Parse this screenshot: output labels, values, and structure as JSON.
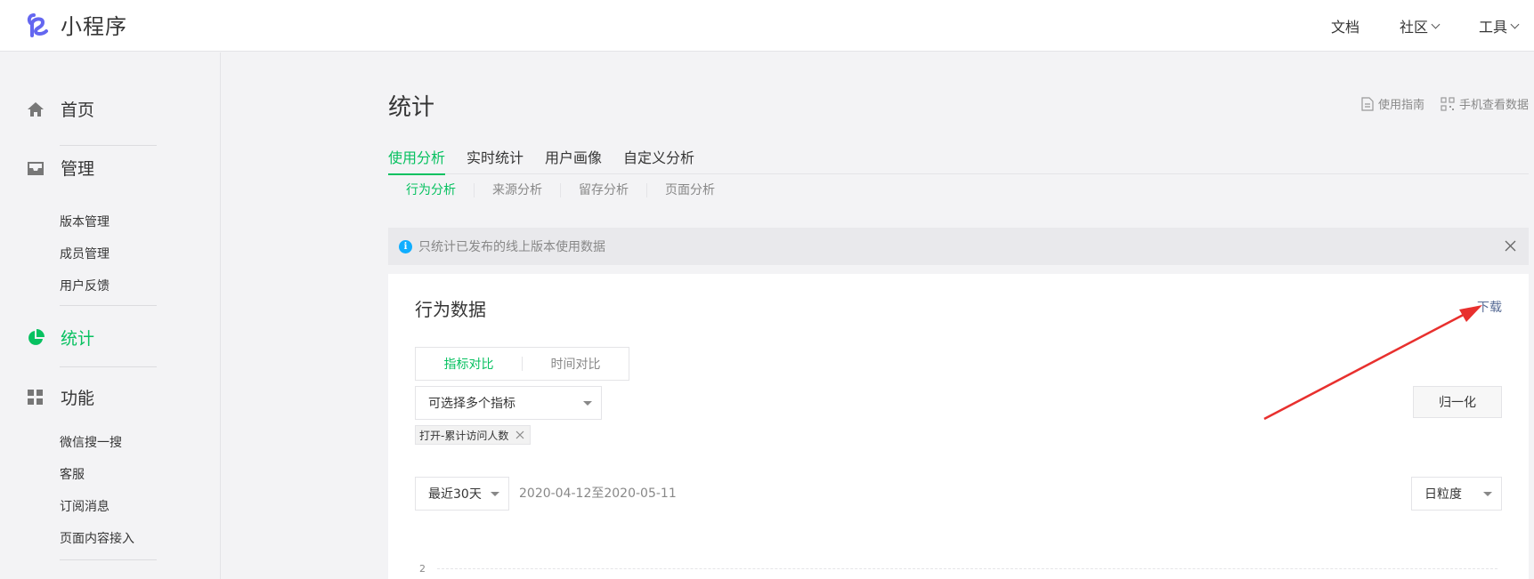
{
  "header": {
    "app_title": "小程序",
    "nav": [
      {
        "label": "文档",
        "has_dropdown": false
      },
      {
        "label": "社区",
        "has_dropdown": true
      },
      {
        "label": "工具",
        "has_dropdown": true
      }
    ]
  },
  "sidebar": {
    "home": "首页",
    "manage": "管理",
    "manage_items": [
      "版本管理",
      "成员管理",
      "用户反馈"
    ],
    "stats": "统计",
    "features": "功能",
    "feature_items": [
      "微信搜一搜",
      "客服",
      "订阅消息",
      "页面内容接入"
    ]
  },
  "page": {
    "title": "统计",
    "links": [
      "使用指南",
      "手机查看数据"
    ],
    "tabs": [
      {
        "label": "使用分析",
        "active": true
      },
      {
        "label": "实时统计",
        "active": false
      },
      {
        "label": "用户画像",
        "active": false
      },
      {
        "label": "自定义分析",
        "active": false
      }
    ],
    "subtabs": [
      {
        "label": "行为分析",
        "active": true
      },
      {
        "label": "来源分析",
        "active": false
      },
      {
        "label": "留存分析",
        "active": false
      },
      {
        "label": "页面分析",
        "active": false
      }
    ],
    "notice": "只统计已发布的线上版本使用数据"
  },
  "card": {
    "title": "行为数据",
    "download": "下载",
    "compare_options": [
      {
        "label": "指标对比",
        "active": true
      },
      {
        "label": "时间对比",
        "active": false
      }
    ],
    "metric_placeholder": "可选择多个指标",
    "normalize_label": "归一化",
    "selected_tag": "打开-累计访问人数",
    "period_select": "最近30天",
    "date_range": "2020-04-12至2020-05-11",
    "granularity_select": "日粒度",
    "y_tick": "2"
  },
  "colors": {
    "accent_green": "#07c160",
    "link_blue": "#576b95",
    "info_blue": "#10aeff",
    "annotation_red": "#e8302e"
  }
}
